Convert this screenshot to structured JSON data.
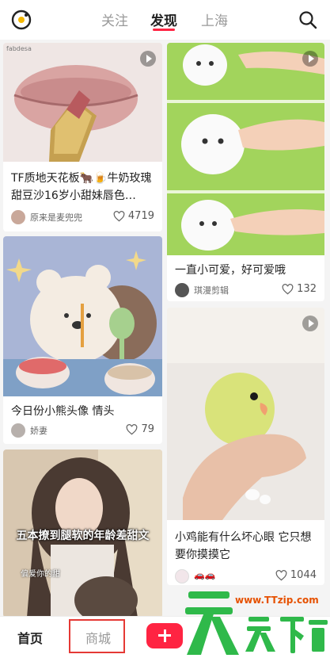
{
  "header": {
    "tabs": [
      "关注",
      "发现",
      "上海"
    ],
    "active_tab": "发现"
  },
  "feed": {
    "left": [
      {
        "title": "TF质地天花板🐂🍺牛奶玫瑰甜豆沙16岁小甜妹唇色…",
        "author": "原来是麦兜兜",
        "likes": "4719",
        "image_text": "fabdesa",
        "video": true
      },
      {
        "title": "今日份小熊头像 情头",
        "author": "娇妻",
        "likes": "79",
        "video": false
      },
      {
        "title": "",
        "author": "",
        "likes": "",
        "overlay_text": "五本撩到腿软的年龄差甜文",
        "watermark": "偏爱你的甜",
        "video": false
      }
    ],
    "right": [
      {
        "title": "一直小可爱，好可爱哦",
        "author": "琪漫剪辑",
        "likes": "132",
        "video": true
      },
      {
        "title": "小鸡能有什么坏心眼 它只想要你摸摸它",
        "author": "🚗🚗",
        "likes": "1044",
        "video": true
      }
    ]
  },
  "bottom_nav": {
    "home": "首页",
    "mall": "商城"
  },
  "watermark": {
    "url": "www.TTzip.com",
    "brand": "天天下载"
  },
  "colors": {
    "accent": "#ff2442",
    "highlight_box": "#e53935"
  }
}
